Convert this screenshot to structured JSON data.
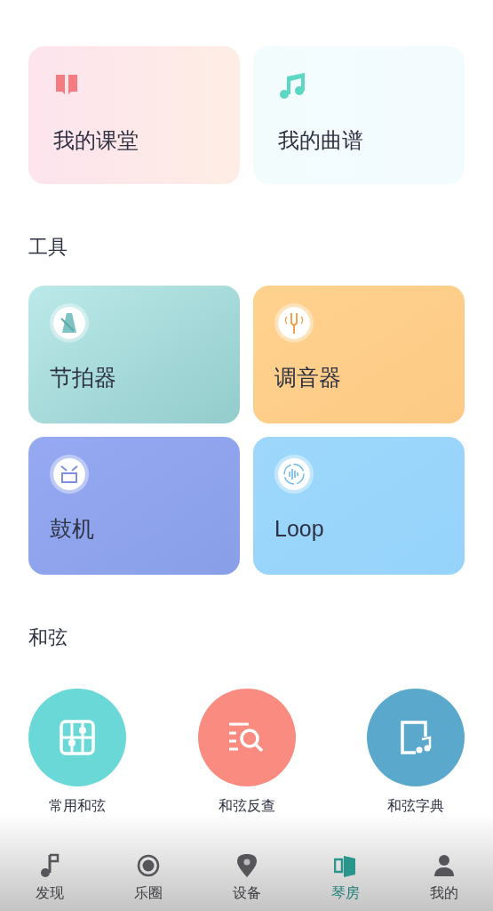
{
  "shortcuts": [
    {
      "kind": "book",
      "label": "我的课堂"
    },
    {
      "kind": "note",
      "label": "我的曲谱"
    }
  ],
  "tools": {
    "title": "工具",
    "items": [
      {
        "kind": "metronome",
        "label": "节拍器"
      },
      {
        "kind": "fork",
        "label": "调音器"
      },
      {
        "kind": "drum",
        "label": "鼓机"
      },
      {
        "kind": "loop",
        "label": "Loop"
      }
    ]
  },
  "chords": {
    "title": "和弦",
    "items": [
      {
        "kind": "grid",
        "label": "常用和弦"
      },
      {
        "kind": "search",
        "label": "和弦反查"
      },
      {
        "kind": "dict",
        "label": "和弦字典"
      }
    ]
  },
  "tab_bar": [
    {
      "kind": "discover",
      "label": "发现",
      "selected": false
    },
    {
      "kind": "circle",
      "label": "乐圈",
      "selected": false
    },
    {
      "kind": "device",
      "label": "设备",
      "selected": false
    },
    {
      "kind": "room",
      "label": "琴房",
      "selected": true
    },
    {
      "kind": "me",
      "label": "我的",
      "selected": false
    }
  ]
}
